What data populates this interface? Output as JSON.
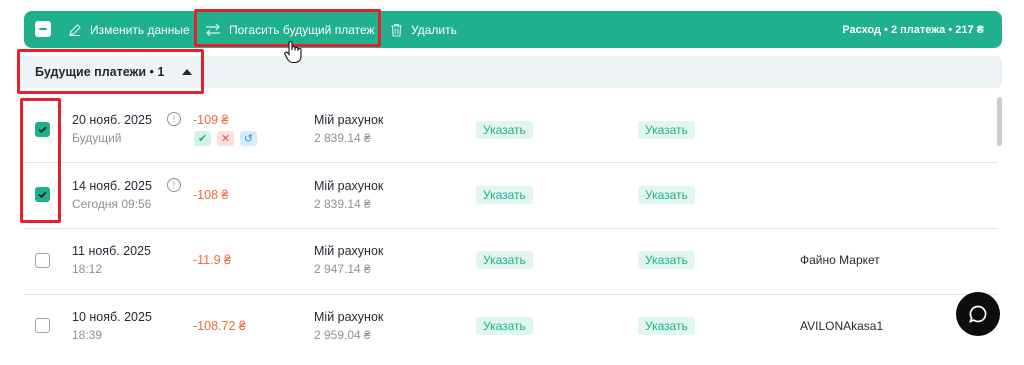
{
  "toolbar": {
    "edit_label": "Изменить данные",
    "pay_label": "Погасить будущий платеж",
    "delete_label": "Удалить",
    "summary": "Расход • 2 платежа • 217 ₴"
  },
  "group": {
    "title": "Будущие платежи • 1"
  },
  "rows": [
    {
      "date": "20 нояб. 2025",
      "sub": "Будущий",
      "amount": "-109 ₴",
      "account": "Мій рахунок",
      "balance": "2 839.14 ₴",
      "tag1": "Указать",
      "tag2": "Указать",
      "merchant": "",
      "checked": true
    },
    {
      "date": "14 нояб. 2025",
      "sub": "Сегодня 09:56",
      "amount": "-108 ₴",
      "account": "Мій рахунок",
      "balance": "2 839.14 ₴",
      "tag1": "Указать",
      "tag2": "Указать",
      "merchant": "",
      "checked": true
    },
    {
      "date": "11 нояб. 2025",
      "sub": "18:12",
      "amount": "-11.9 ₴",
      "account": "Мій рахунок",
      "balance": "2 947.14 ₴",
      "tag1": "Указать",
      "tag2": "Указать",
      "merchant": "Файно Маркет",
      "checked": false
    },
    {
      "date": "10 нояб. 2025",
      "sub": "18:39",
      "amount": "-108.72 ₴",
      "account": "Мій рахунок",
      "balance": "2 959.04 ₴",
      "tag1": "Указать",
      "tag2": "Указать",
      "merchant": "AVILONAkasa1",
      "checked": false
    }
  ],
  "icons": {
    "info": "info-icon",
    "confirm": "check-icon",
    "reject": "close-icon",
    "undo": "undo-icon",
    "chat": "chat-bubble-icon"
  },
  "colors": {
    "accent": "#1fb08e",
    "expense": "#f26b3a",
    "highlight": "#e3202b"
  }
}
